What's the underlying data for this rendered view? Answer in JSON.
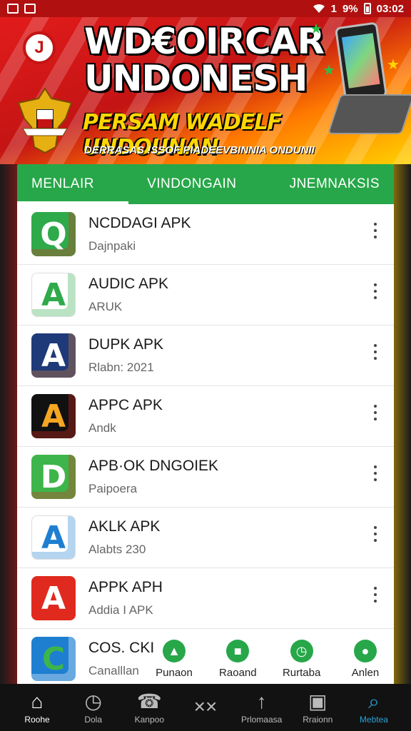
{
  "status_bar": {
    "signal_text": "1",
    "battery_text": "9%",
    "time": "03:02"
  },
  "banner": {
    "title_line1": "WD€OIRCAR",
    "title_line2": "UNDONESH",
    "subtitle": "PERSAM WADELF UNDOUNAN",
    "tagline": "DERRASAS !SSOF PIADEEVBINNIA ONDUNII",
    "logo_glyph": "J"
  },
  "tabs": [
    {
      "label": "MENLAIR",
      "active": true
    },
    {
      "label": "VINDONGAIN",
      "active": false
    },
    {
      "label": "JNEMNAKSIS",
      "active": false
    }
  ],
  "apps": [
    {
      "name": "NCDDAGI APK",
      "sub": "Dajnpaki",
      "icon_glyph": "Q",
      "icon_colors": [
        "#2eaa4a",
        "#ffffff",
        "#e02a1f"
      ]
    },
    {
      "name": "AUDIC APK",
      "sub": "ARUK",
      "icon_glyph": "A",
      "icon_colors": [
        "#ffffff",
        "#e02a1f",
        "#2eaa4a"
      ]
    },
    {
      "name": "DUPK APK",
      "sub": "Rlabn: 2021",
      "icon_glyph": "A",
      "icon_colors": [
        "#1f3a78",
        "#ffffff",
        "#e0852a"
      ]
    },
    {
      "name": "APPC APK",
      "sub": "Andk",
      "icon_glyph": "A",
      "icon_colors": [
        "#111111",
        "#f5a623",
        "#e02a1f"
      ]
    },
    {
      "name": "APB·OK DNGOIEK",
      "sub": "Paipoera",
      "icon_glyph": "D",
      "icon_colors": [
        "#3db54a",
        "#ffffff",
        "#e02a1f"
      ]
    },
    {
      "name": "AKLK APK",
      "sub": "Alabts 230",
      "icon_glyph": "A",
      "icon_colors": [
        "#ffffff",
        "#2eaa4a",
        "#1e7fd0"
      ]
    },
    {
      "name": "APPK APH",
      "sub": "Addia I APK",
      "icon_glyph": "A",
      "icon_colors": [
        "#e02a1f",
        "#ffffff",
        "#e02a1f"
      ]
    },
    {
      "name": "COS. CKI",
      "sub": "Canalllan",
      "icon_glyph": "C",
      "icon_colors": [
        "#1e7fd0",
        "#3db54a",
        "#ffffff"
      ]
    }
  ],
  "shortcuts": [
    {
      "label": "Punaon",
      "icon": "pin-icon",
      "glyph": "▲"
    },
    {
      "label": "Raoand",
      "icon": "bag-icon",
      "glyph": "■"
    },
    {
      "label": "Rurtaba",
      "icon": "timer-icon",
      "glyph": "◷"
    },
    {
      "label": "Anlen",
      "icon": "leaf-icon",
      "glyph": "●"
    }
  ],
  "bottom_nav": [
    {
      "label": "Roohe",
      "icon": "home-icon",
      "glyph": "⌂",
      "state": "active"
    },
    {
      "label": "Dola",
      "icon": "clock-icon",
      "glyph": "◷",
      "state": ""
    },
    {
      "label": "Kanpoo",
      "icon": "phone-icon",
      "glyph": "☎",
      "state": ""
    },
    {
      "label": "",
      "icon": "xx-icon",
      "glyph": "××",
      "state": ""
    },
    {
      "label": "Prlomaasa",
      "icon": "rocket-icon",
      "glyph": "↑",
      "state": ""
    },
    {
      "label": "Rraionn",
      "icon": "window-icon",
      "glyph": "▣",
      "state": ""
    },
    {
      "label": "Mebtea",
      "icon": "search-icon",
      "glyph": "⌕",
      "state": "search"
    }
  ]
}
